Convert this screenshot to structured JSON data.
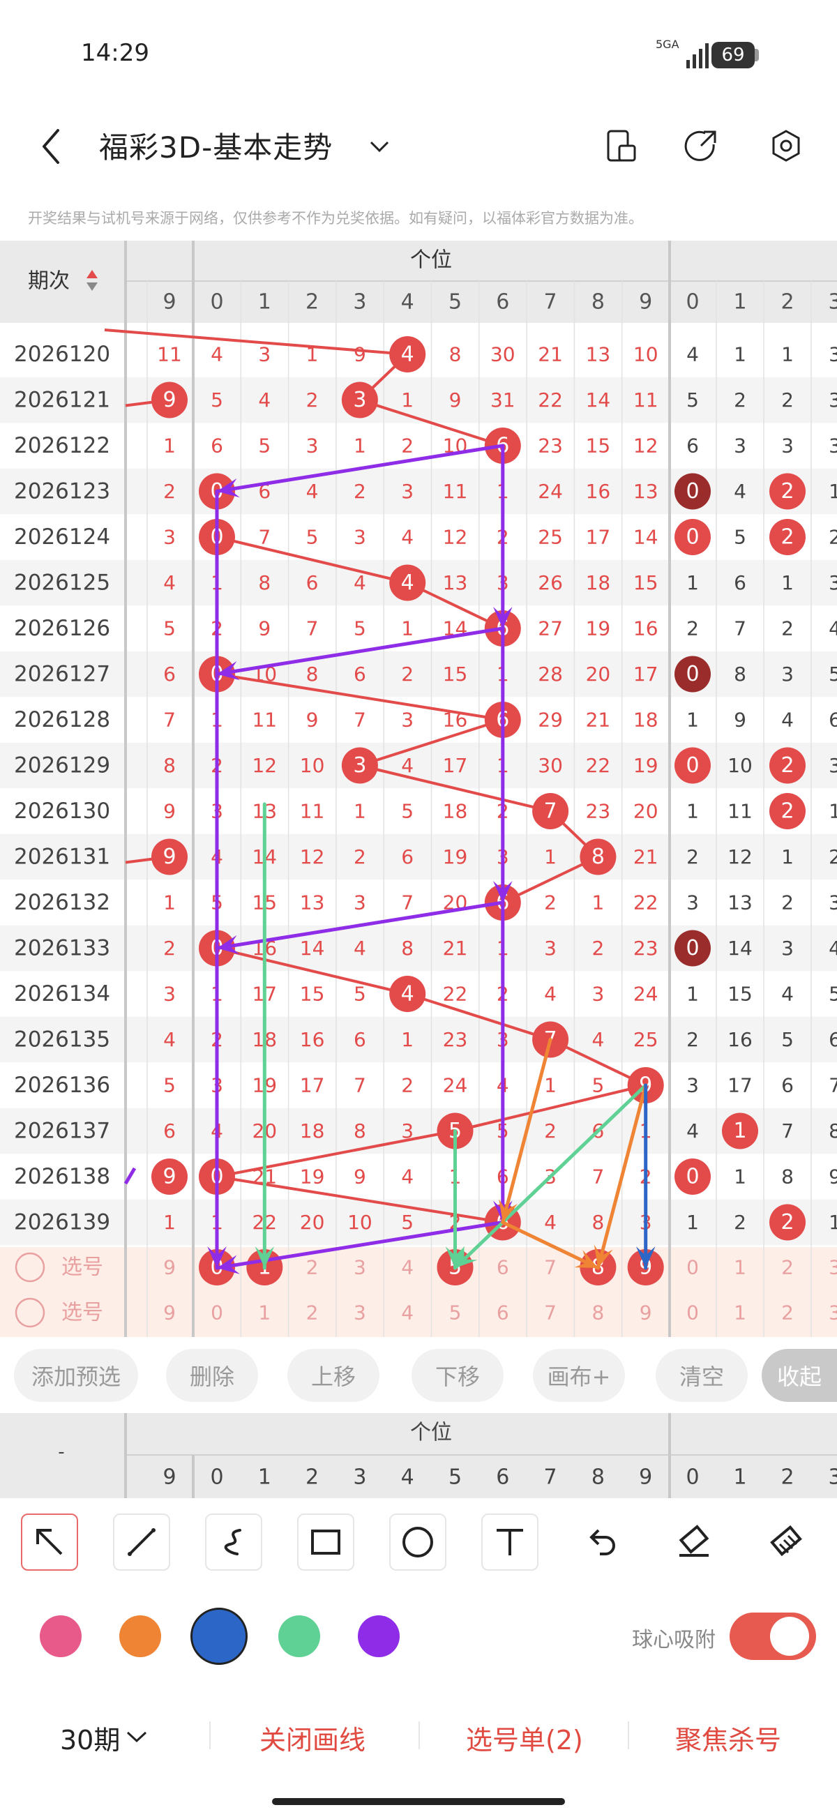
{
  "status_bar": {
    "time": "14:29",
    "network": "5GA",
    "battery": "69"
  },
  "header": {
    "title": "福彩3D-基本走势",
    "dropdown_icon": "chevron-down-icon",
    "icons": [
      "back-icon",
      "device-icon",
      "share-icon",
      "settings-icon"
    ]
  },
  "disclaimer": "开奖结果与试机号来源于网络，仅供参考不作为兑奖依据。如有疑问，以福体彩官方数据为准。",
  "table": {
    "period_header": "期次",
    "group_label": "个位",
    "prev_digit": "9",
    "digits": [
      "0",
      "1",
      "2",
      "3",
      "4",
      "5",
      "6",
      "7",
      "8",
      "9"
    ],
    "right_digits": [
      "0",
      "1",
      "2",
      "3"
    ],
    "rows": [
      {
        "period": "2026120",
        "prev": "11",
        "cells": [
          "4",
          "3",
          "1",
          "9",
          "4",
          "8",
          "30",
          "21",
          "13",
          "10"
        ],
        "right": [
          "4",
          "1",
          "1",
          "3"
        ]
      },
      {
        "period": "2026121",
        "prev": "9",
        "cells": [
          "5",
          "4",
          "2",
          "3",
          "1",
          "9",
          "31",
          "22",
          "14",
          "11"
        ],
        "right": [
          "5",
          "2",
          "2",
          "3"
        ]
      },
      {
        "period": "2026122",
        "prev": "1",
        "cells": [
          "6",
          "5",
          "3",
          "1",
          "2",
          "10",
          "6",
          "23",
          "15",
          "12"
        ],
        "right": [
          "6",
          "3",
          "3",
          "3"
        ]
      },
      {
        "period": "2026123",
        "prev": "2",
        "cells": [
          "0",
          "6",
          "4",
          "2",
          "3",
          "11",
          "1",
          "24",
          "16",
          "13"
        ],
        "right": [
          "0",
          "4",
          "2",
          "1"
        ]
      },
      {
        "period": "2026124",
        "prev": "3",
        "cells": [
          "0",
          "7",
          "5",
          "3",
          "4",
          "12",
          "2",
          "25",
          "17",
          "14"
        ],
        "right": [
          "0",
          "5",
          "2",
          "2"
        ]
      },
      {
        "period": "2026125",
        "prev": "4",
        "cells": [
          "1",
          "8",
          "6",
          "4",
          "4",
          "13",
          "3",
          "26",
          "18",
          "15"
        ],
        "right": [
          "1",
          "6",
          "1",
          "3"
        ]
      },
      {
        "period": "2026126",
        "prev": "5",
        "cells": [
          "2",
          "9",
          "7",
          "5",
          "1",
          "14",
          "6",
          "27",
          "19",
          "16"
        ],
        "right": [
          "2",
          "7",
          "2",
          "4"
        ]
      },
      {
        "period": "2026127",
        "prev": "6",
        "cells": [
          "0",
          "10",
          "8",
          "6",
          "2",
          "15",
          "1",
          "28",
          "20",
          "17"
        ],
        "right": [
          "0",
          "8",
          "3",
          "5"
        ]
      },
      {
        "period": "2026128",
        "prev": "7",
        "cells": [
          "1",
          "11",
          "9",
          "7",
          "3",
          "16",
          "6",
          "29",
          "21",
          "18"
        ],
        "right": [
          "1",
          "9",
          "4",
          "6"
        ]
      },
      {
        "period": "2026129",
        "prev": "8",
        "cells": [
          "2",
          "12",
          "10",
          "3",
          "4",
          "17",
          "1",
          "30",
          "22",
          "19"
        ],
        "right": [
          "0",
          "10",
          "2",
          "3"
        ]
      },
      {
        "period": "2026130",
        "prev": "9",
        "cells": [
          "3",
          "13",
          "11",
          "1",
          "5",
          "18",
          "2",
          "7",
          "23",
          "20"
        ],
        "right": [
          "1",
          "11",
          "2",
          "1"
        ]
      },
      {
        "period": "2026131",
        "prev": "9",
        "cells": [
          "4",
          "14",
          "12",
          "2",
          "6",
          "19",
          "3",
          "1",
          "8",
          "21"
        ],
        "right": [
          "2",
          "12",
          "1",
          "2"
        ]
      },
      {
        "period": "2026132",
        "prev": "1",
        "cells": [
          "5",
          "15",
          "13",
          "3",
          "7",
          "20",
          "6",
          "2",
          "1",
          "22"
        ],
        "right": [
          "3",
          "13",
          "2",
          "3"
        ]
      },
      {
        "period": "2026133",
        "prev": "2",
        "cells": [
          "0",
          "16",
          "14",
          "4",
          "8",
          "21",
          "1",
          "3",
          "2",
          "23"
        ],
        "right": [
          "0",
          "14",
          "3",
          "4"
        ]
      },
      {
        "period": "2026134",
        "prev": "3",
        "cells": [
          "1",
          "17",
          "15",
          "5",
          "4",
          "22",
          "2",
          "4",
          "3",
          "24"
        ],
        "right": [
          "1",
          "15",
          "4",
          "5"
        ]
      },
      {
        "period": "2026135",
        "prev": "4",
        "cells": [
          "2",
          "18",
          "16",
          "6",
          "1",
          "23",
          "3",
          "7",
          "4",
          "25"
        ],
        "right": [
          "2",
          "16",
          "5",
          "6"
        ]
      },
      {
        "period": "2026136",
        "prev": "5",
        "cells": [
          "3",
          "19",
          "17",
          "7",
          "2",
          "24",
          "4",
          "1",
          "5",
          "9"
        ],
        "right": [
          "3",
          "17",
          "6",
          "7"
        ]
      },
      {
        "period": "2026137",
        "prev": "6",
        "cells": [
          "4",
          "20",
          "18",
          "8",
          "3",
          "5",
          "5",
          "2",
          "6",
          "1"
        ],
        "right": [
          "4",
          "1",
          "7",
          "8"
        ]
      },
      {
        "period": "2026138",
        "prev": "9",
        "cells": [
          "0",
          "21",
          "19",
          "9",
          "4",
          "1",
          "6",
          "3",
          "7",
          "2"
        ],
        "right": [
          "0",
          "1",
          "8",
          "9"
        ]
      },
      {
        "period": "2026139",
        "prev": "1",
        "cells": [
          "1",
          "22",
          "20",
          "10",
          "5",
          "2",
          "6",
          "4",
          "8",
          "3"
        ],
        "right": [
          "1",
          "2",
          "2",
          "1"
        ]
      }
    ],
    "select_label": "选号"
  },
  "actions": {
    "add_preset": "添加预选",
    "delete": "删除",
    "move_up": "上移",
    "move_down": "下移",
    "canvas_plus": "画布+",
    "clear": "清空",
    "collapse": "收起"
  },
  "sticky_header": {
    "left": "-",
    "group_label": "个位"
  },
  "drawing_tools": [
    "select-arrow-icon",
    "line-icon",
    "freehand-icon",
    "rectangle-icon",
    "circle-icon",
    "text-icon",
    "undo-icon",
    "eraser-icon",
    "clear-icon"
  ],
  "colors": {
    "pink": "#e85a8a",
    "orange": "#ef8435",
    "blue": "#2c66c6",
    "green": "#5fd195",
    "purple": "#8e2ce8",
    "ball_red": "#e34a4a",
    "ball_dark": "#9b2c2c"
  },
  "snap": {
    "label": "球心吸附",
    "enabled": true
  },
  "bottom_bar": {
    "periods": "30期",
    "close_lines": "关闭画线",
    "pick_list": "选号单(2)",
    "focus_kill": "聚焦杀号"
  }
}
